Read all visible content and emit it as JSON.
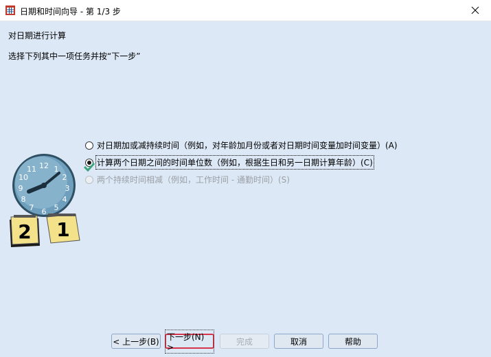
{
  "window": {
    "title": "日期和时间向导 - 第 1/3 步"
  },
  "heading": "对日期进行计算",
  "instruction": "选择下列其中一项任务并按“下一步”",
  "options": [
    {
      "label": "对日期加或减持续时间（例如，对年龄加月份或者对日期时间变量加时间变量）(A)",
      "checked": false,
      "enabled": true
    },
    {
      "label": "计算两个日期之间的时间单位数（例如，根据生日和另一日期计算年龄）(C)",
      "checked": true,
      "enabled": true
    },
    {
      "label": "两个持续时间相减（例如，工作时间 - 通勤时间）(S)",
      "checked": false,
      "enabled": false
    }
  ],
  "clock_numbers": [
    "12",
    "1",
    "2",
    "3",
    "4",
    "5",
    "6",
    "7",
    "8",
    "9",
    "10",
    "11"
  ],
  "calendar_days": [
    "2",
    "1"
  ],
  "buttons": {
    "back": "< 上一步(B)",
    "next": "下一步(N) >",
    "finish": "完成",
    "cancel": "取消",
    "help": "帮助"
  },
  "colors": {
    "background": "#dce8f5",
    "default_button_border": "#d5344b",
    "clock_face": "#6e9fbd"
  }
}
